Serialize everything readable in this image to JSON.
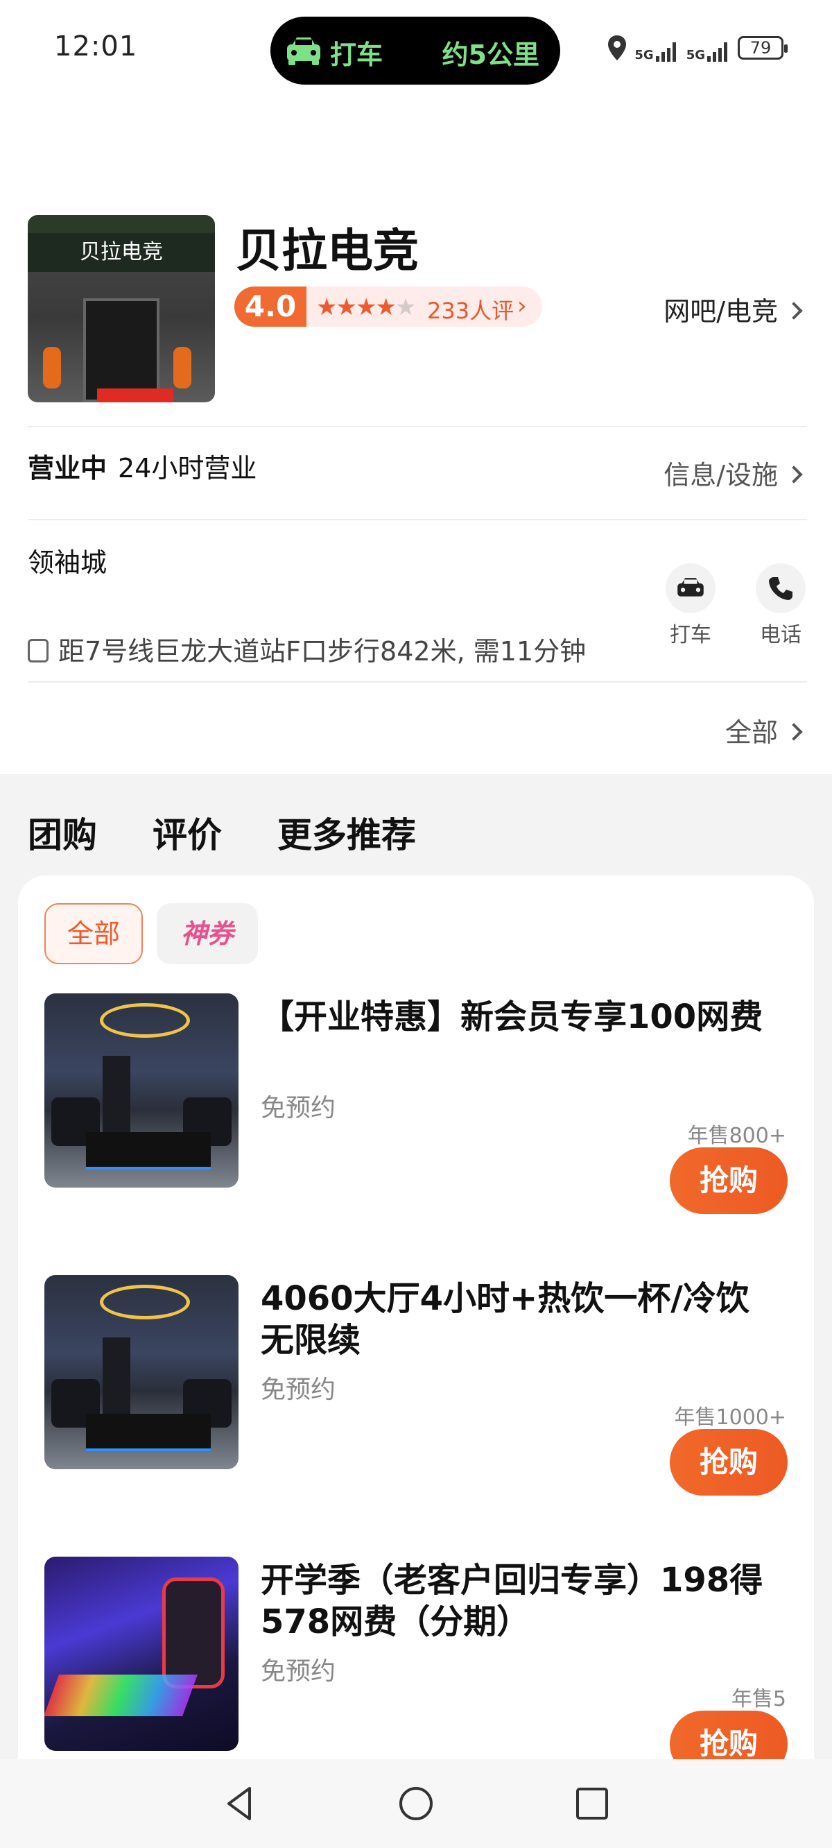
{
  "status_bar": {
    "time": "12:01",
    "island_left": "打车",
    "island_right": "约5公里",
    "signal_1": "5G",
    "signal_2": "5G",
    "battery": "79"
  },
  "shop": {
    "name": "贝拉电竞",
    "storefront_text": "贝拉电竞",
    "rating": "4.0",
    "stars": 4,
    "reviews": "233人评",
    "category": "网吧/电竞",
    "status": "营业中",
    "hours": "24小时营业",
    "info_link": "信息/设施",
    "district": "领袖城",
    "subway": "距7号线巨龙大道站F口步行842米, 需11分钟",
    "actions": [
      {
        "label": "打车",
        "icon": "car-icon"
      },
      {
        "label": "电话",
        "icon": "phone-icon"
      }
    ],
    "all_link": "全部"
  },
  "tabs": [
    "团购",
    "评价",
    "更多推荐"
  ],
  "filters": {
    "all": "全部",
    "god_coupon": "神券"
  },
  "deals": [
    {
      "title": "【开业特惠】新会员专享100网费",
      "sub": "免预约",
      "sold": "年售800+",
      "button": "抢购",
      "image": "hall"
    },
    {
      "title": "4060大厅4小时+热饮一杯/冷饮无限续",
      "sub": "免预约",
      "sold": "年售1000+",
      "button": "抢购",
      "image": "hall"
    },
    {
      "title": "开学季（老客户回归专享）198得578网费（分期）",
      "sub": "免预约",
      "sold": "年售5",
      "button": "抢购",
      "image": "gaming"
    }
  ],
  "colors": {
    "accent": "#ee5a2e",
    "rating_bg": "#f06a32",
    "island_text": "#7fe08a"
  }
}
